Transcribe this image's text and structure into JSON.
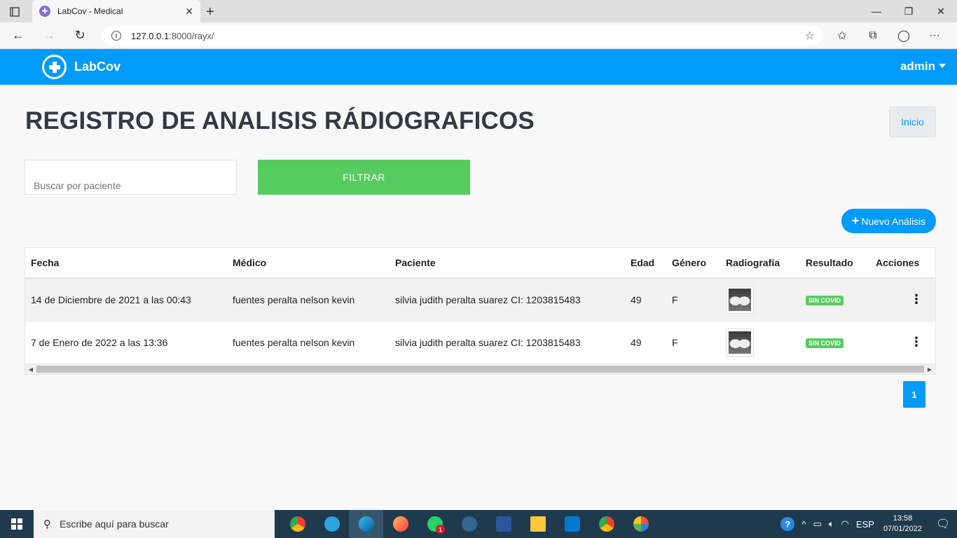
{
  "browser": {
    "tab_title": "LabCov - Medical",
    "url_host": "127.0.0.1",
    "url_path": ":8000/rayx/"
  },
  "navbar": {
    "brand": "LabCov",
    "user": "admin"
  },
  "page": {
    "title": "REGISTRO DE ANALISIS RÁDIOGRAFICOS",
    "home_button": "Inicio",
    "search_placeholder": "Buscar por paciente",
    "filter_button": "FILTRAR",
    "new_button": "Nuevo Análisis",
    "pagination_current": "1"
  },
  "table": {
    "headers": [
      "Fecha",
      "Médico",
      "Paciente",
      "Edad",
      "Género",
      "Radiografía",
      "Resultado",
      "Acciones"
    ],
    "rows": [
      {
        "fecha": "14 de Diciembre de 2021 a las 00:43",
        "medico": "fuentes peralta nelson kevin",
        "paciente": "silvia judith peralta suarez CI: 1203815483",
        "edad": "49",
        "genero": "F",
        "resultado": "SIN COVID"
      },
      {
        "fecha": "7 de Enero de 2022 a las 13:36",
        "medico": "fuentes peralta nelson kevin",
        "paciente": "silvia judith peralta suarez CI: 1203815483",
        "edad": "49",
        "genero": "F",
        "resultado": "SIN COVID"
      }
    ]
  },
  "taskbar": {
    "search_placeholder": "Escribe aquí para buscar",
    "language": "ESP",
    "time": "13:58",
    "date": "07/01/2022",
    "whatsapp_badge": "1"
  },
  "colors": {
    "primary": "#039bf9",
    "success": "#56cc60"
  }
}
